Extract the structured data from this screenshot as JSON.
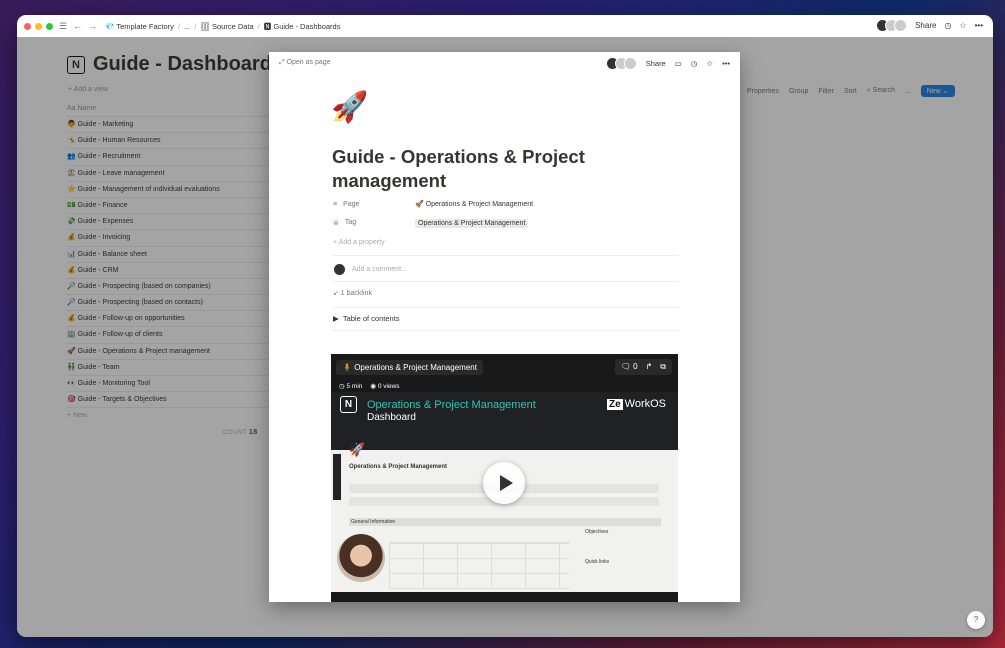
{
  "titlebar": {
    "breadcrumbs": [
      "Template Factory",
      "...",
      "Source Data",
      "Guide - Dashboards"
    ],
    "share": "Share"
  },
  "database": {
    "title": "Guide - Dashboards",
    "add_view": "+ Add a view",
    "toolbar": [
      "Properties",
      "Group",
      "Filter",
      "Sort",
      "Search",
      "..."
    ],
    "new_button": "New",
    "column_name": "Name",
    "rows": [
      "👨 Guide - Marketing",
      "🤸 Guide - Human Resources",
      "👥 Guide - Recruitment",
      "🏖️ Guide - Leave management",
      "⭐ Guide - Management of individual evaluations",
      "💵 Guide - Finance",
      "💸 Guide - Expenses",
      "💰 Guide - Invoicing",
      "📊 Guide - Balance sheet",
      "💰 Guide - CRM",
      "🔎 Guide - Prospecting (based on companies)",
      "🔎 Guide - Prospecting (based on contacts)",
      "💰 Guide - Follow-up on opportunities",
      "🏢 Guide - Follow-up of clients",
      "🚀 Guide - Operations & Project management",
      "👬 Guide - Team",
      "👀 Guide - Monitoring Tool",
      "🎯 Guide - Targets & Objectives"
    ],
    "new_row": "+ New",
    "count_label": "COUNT",
    "count_value": "18"
  },
  "modal": {
    "open_as_page": "Open as page",
    "share": "Share",
    "page_icon": "🚀",
    "title": "Guide - Operations & Project management",
    "properties": [
      {
        "label": "Page",
        "value": "🚀 Operations & Project Management"
      },
      {
        "label": "Tag",
        "value": "Operations & Project Management"
      }
    ],
    "add_property": "+ Add a property",
    "comment_placeholder": "Add a comment...",
    "backlink": "↙ 1 backlink",
    "toc": "Table of contents"
  },
  "video": {
    "title": "Operations & Project Management",
    "comments": "0",
    "duration": "5 min",
    "views": "0 views",
    "banner_title": "Operations & Project Management",
    "banner_sub": "Dashboard",
    "brand_ze": "Ze",
    "brand_rest": "WorkOS",
    "inner_heading": "Operations & Project Management",
    "general_info": "General Information",
    "objectives": "Objectives",
    "quick_links": "Quick links"
  },
  "colors": {
    "accent": "#2383e2",
    "teal": "#2ec4b6"
  }
}
